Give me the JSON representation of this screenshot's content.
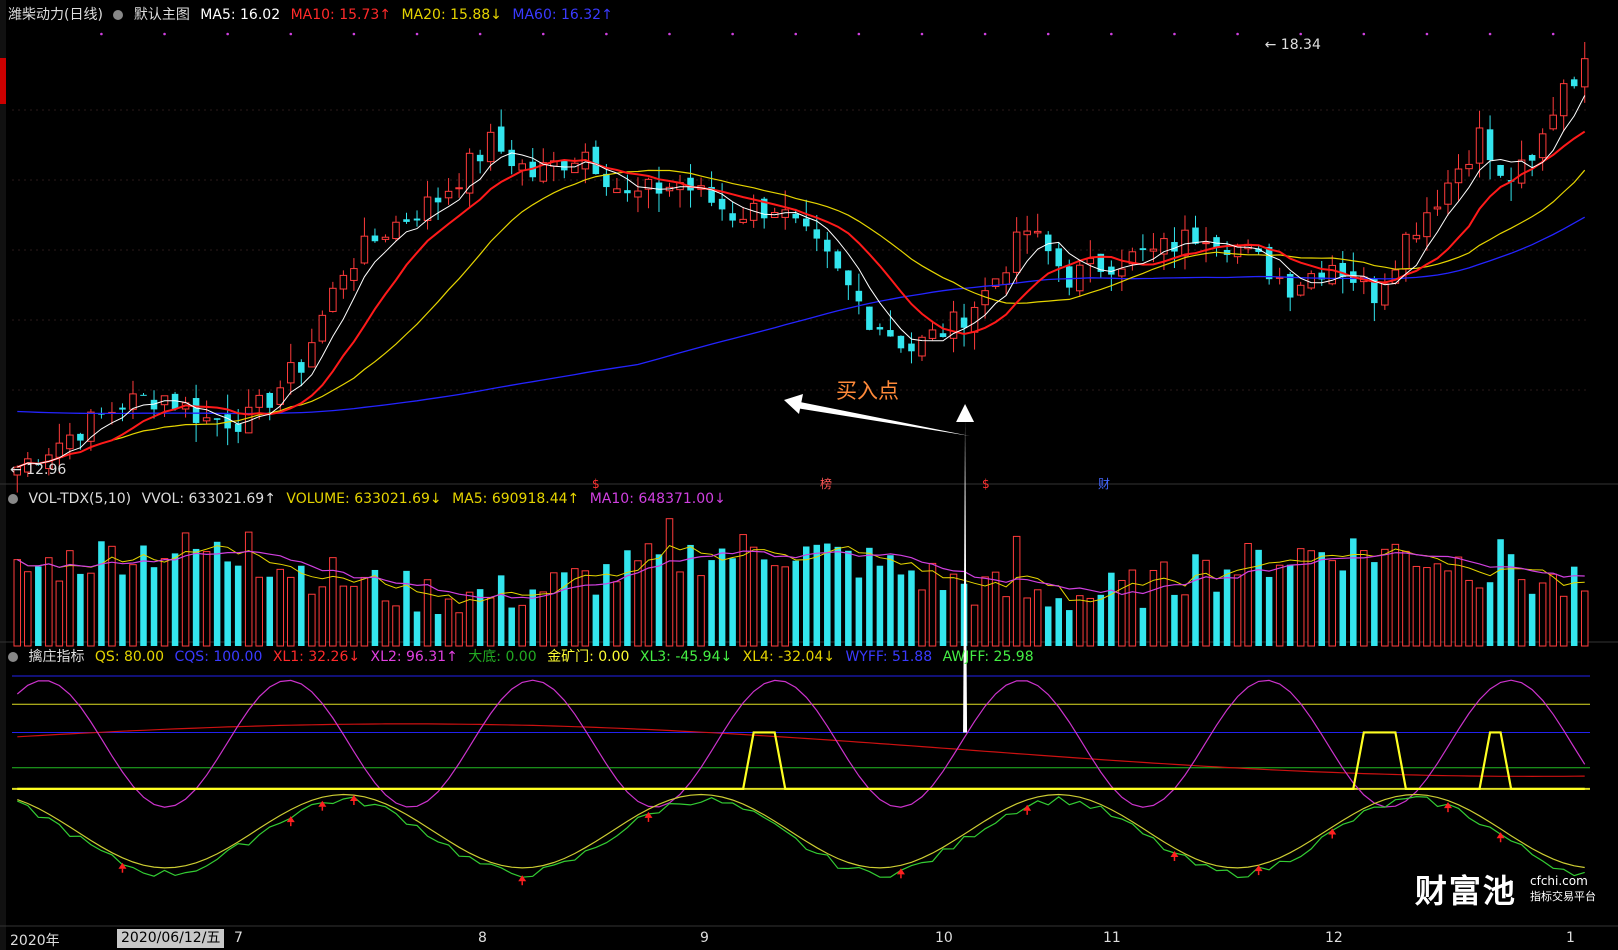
{
  "title_bar": {
    "stock": "潍柴动力(日线)",
    "main_chart": "默认主图",
    "ma5": "MA5: 16.02",
    "ma10": "MA10: 15.73↑",
    "ma20": "MA20: 15.88↓",
    "ma60": "MA60: 16.32↑"
  },
  "volume_bar": {
    "name": "VOL-TDX(5,10)",
    "vvol": "VVOL: 633021.69↑",
    "volume": "VOLUME: 633021.69↓",
    "ma5": "MA5: 690918.44↑",
    "ma10": "MA10: 648371.00↓"
  },
  "indicator_bar": {
    "name": "擒庄指标",
    "qs": "QS: 80.00",
    "cqs": "CQS: 100.00",
    "xl1": "XL1: 32.26↓",
    "xl2": "XL2: 96.31↑",
    "dadi": "大底: 0.00",
    "jinkuangmen": "金矿门: 0.00",
    "xl3": "XL3: -45.94↓",
    "xl4": "XL4: -32.04↓",
    "wyff": "WYFF: 51.88",
    "awjff": "AWJFF: 25.98"
  },
  "annotations": {
    "buy_point": "买入点",
    "high": "18.34",
    "low": "12.96"
  },
  "event_markers": [
    "$",
    "榜",
    "$",
    "财"
  ],
  "axis": {
    "year": "2020年",
    "cursor_date": "2020/06/12/五",
    "months": [
      "7",
      "8",
      "9",
      "10",
      "11",
      "12",
      "1"
    ]
  },
  "watermark": {
    "brand": "财富池",
    "url": "cfchi.com",
    "sub": "指标交易平台"
  },
  "colors": {
    "background": "#000000",
    "up": "#ff3b3b",
    "down": "#33e5ee",
    "ma5": "#ffffff",
    "ma10": "#ff1a1a",
    "ma20": "#e5d400",
    "ma60": "#2424ff",
    "vol_ma5": "#e5d400",
    "vol_ma10": "#d040e0",
    "xl1": "#cc1111",
    "xl2": "#cc33cc",
    "xl3": "#33cc33",
    "xl4": "#cccc33",
    "signal": "#ffff22",
    "arrow": "#ff2020",
    "ref_blue": "#2222ee",
    "ref_yellow": "#dddd22",
    "ref_green": "#22bb22"
  },
  "chart_data": {
    "type": "candlestick",
    "ylim": [
      12.96,
      18.34
    ],
    "n_bars": 150,
    "price_anchors": [
      [
        0,
        13.0
      ],
      [
        5,
        13.4
      ],
      [
        10,
        13.8
      ],
      [
        14,
        13.9
      ],
      [
        18,
        13.6
      ],
      [
        22,
        13.6
      ],
      [
        27,
        14.3
      ],
      [
        31,
        15.5
      ],
      [
        35,
        16.0
      ],
      [
        40,
        16.4
      ],
      [
        45,
        17.1
      ],
      [
        49,
        16.7
      ],
      [
        54,
        17.0
      ],
      [
        58,
        16.4
      ],
      [
        63,
        16.6
      ],
      [
        68,
        16.2
      ],
      [
        72,
        16.3
      ],
      [
        77,
        15.6
      ],
      [
        81,
        14.9
      ],
      [
        85,
        14.5
      ],
      [
        89,
        14.8
      ],
      [
        92,
        15.2
      ],
      [
        96,
        16.0
      ],
      [
        100,
        15.4
      ],
      [
        104,
        15.6
      ],
      [
        108,
        15.7
      ],
      [
        113,
        16.0
      ],
      [
        117,
        15.7
      ],
      [
        121,
        15.3
      ],
      [
        125,
        15.6
      ],
      [
        129,
        15.2
      ],
      [
        132,
        15.9
      ],
      [
        136,
        16.6
      ],
      [
        139,
        17.2
      ],
      [
        141,
        16.6
      ],
      [
        144,
        16.8
      ],
      [
        147,
        17.9
      ],
      [
        150,
        18.1
      ],
      [
        154,
        17.7
      ],
      [
        158,
        17.1
      ]
    ],
    "volume_ylim": [
      0,
      1000000
    ],
    "indicator_ylim": [
      -70,
      110
    ],
    "signal_levels": [
      0,
      100
    ],
    "reference_lines": [
      110,
      90,
      70,
      45,
      30
    ],
    "buy_signal_index": 90
  }
}
